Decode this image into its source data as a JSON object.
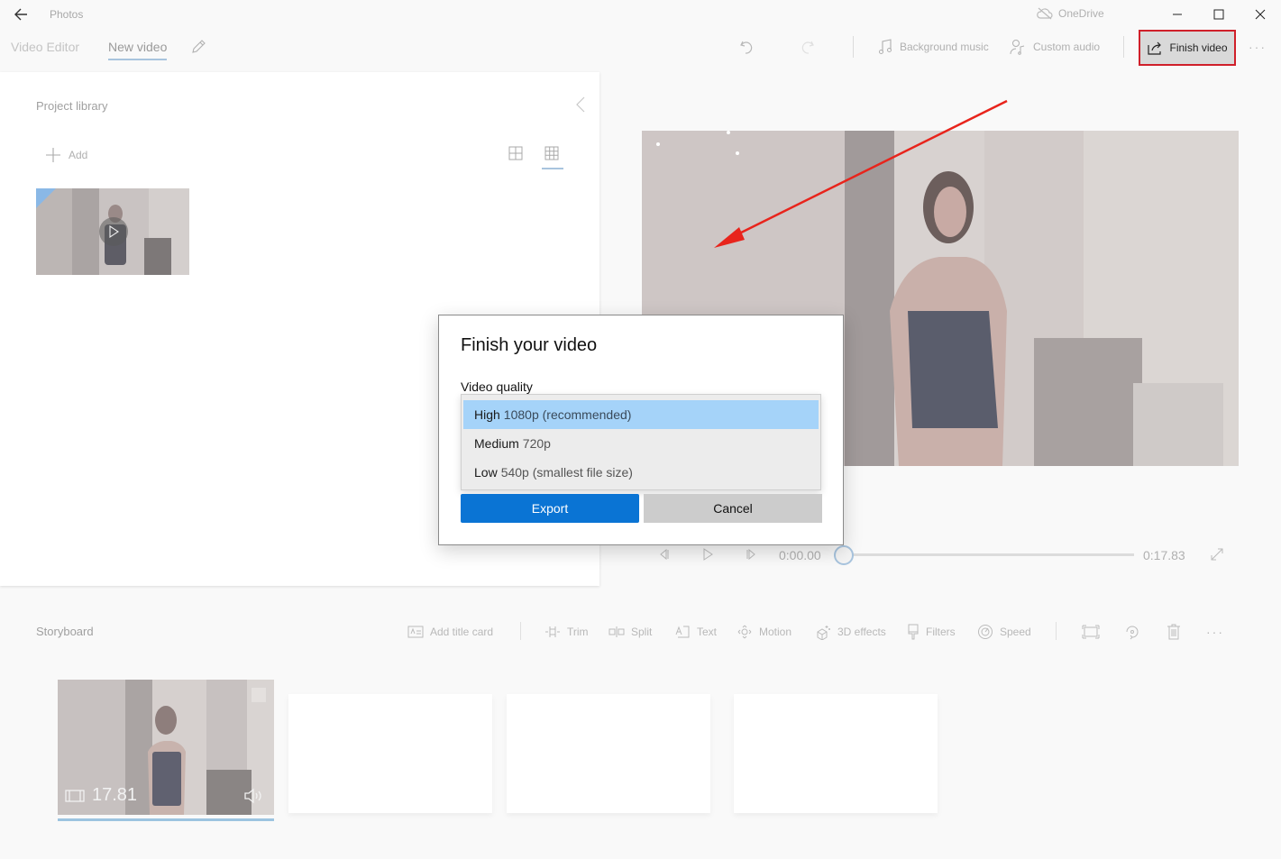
{
  "titlebar": {
    "app_name": "Photos",
    "onedrive_label": "OneDrive"
  },
  "toolbar": {
    "breadcrumb_root": "Video Editor",
    "breadcrumb_current": "New video",
    "background_music": "Background music",
    "custom_audio": "Custom audio",
    "finish_video": "Finish video",
    "more": "···"
  },
  "library": {
    "title": "Project library",
    "add_label": "Add"
  },
  "playback": {
    "current_time": "0:00.00",
    "end_time": "0:17.83",
    "progress_fraction": 0.0
  },
  "storyboard": {
    "title": "Storyboard",
    "tools": {
      "add_title_card": "Add title card",
      "trim": "Trim",
      "split": "Split",
      "text": "Text",
      "motion": "Motion",
      "effects_3d": "3D effects",
      "filters": "Filters",
      "speed": "Speed",
      "more": "···"
    },
    "clips": [
      {
        "duration": "17.81"
      }
    ]
  },
  "dialog": {
    "title": "Finish your video",
    "quality_label": "Video quality",
    "options": [
      {
        "name": "High",
        "detail": "1080p (recommended)",
        "selected": true
      },
      {
        "name": "Medium",
        "detail": "720p",
        "selected": false
      },
      {
        "name": "Low",
        "detail": "540p (smallest file size)",
        "selected": false
      }
    ],
    "export_label": "Export",
    "cancel_label": "Cancel"
  },
  "colors": {
    "accent": "#0a74d4",
    "selected_option": "#a5d3f9",
    "highlight_box": "#d0202a",
    "annotation_arrow": "#e8241c"
  }
}
